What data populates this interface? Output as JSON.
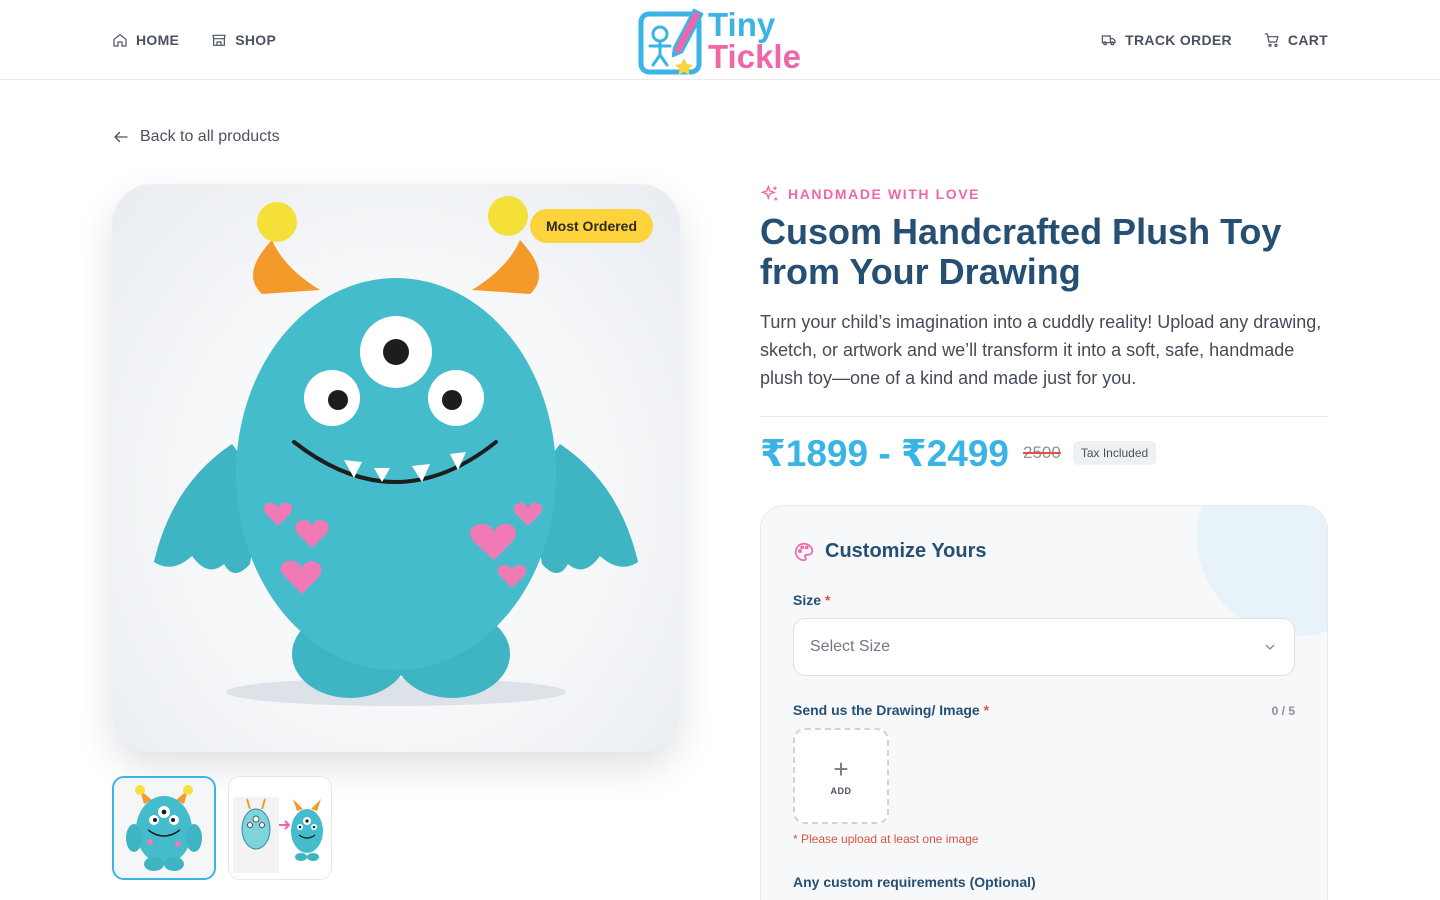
{
  "nav": {
    "home": "HOME",
    "shop": "SHOP",
    "track_order": "TRACK ORDER",
    "cart": "CART"
  },
  "logo": {
    "line1": "Tiny",
    "line2": "Tickle"
  },
  "back_link": "Back to all products",
  "product": {
    "badge": "Most Ordered",
    "eyebrow": "HANDMADE WITH LOVE",
    "title": "Cusom Handcrafted Plush Toy from Your Drawing",
    "description": "Turn your child’s imagination into a cuddly reality! Upload any drawing, sketch, or artwork and we’ll transform it into a soft, safe, handmade plush toy—one of a kind and made just for you.",
    "price": "₹1899 - ₹2499",
    "original_price": "2500",
    "tax_note": "Tax Included"
  },
  "customize": {
    "title": "Customize Yours",
    "size_label": "Size",
    "required_mark": "*",
    "size_placeholder": "Select Size",
    "drawing_label": "Send us the Drawing/ Image",
    "upload_count": "0 / 5",
    "upload_add": "ADD",
    "upload_plus": "+",
    "upload_error": "* Please upload at least one image",
    "custom_req_label": "Any custom requirements (Optional)"
  },
  "colors": {
    "brand_blue": "#39b4e4",
    "brand_pink": "#f066a8",
    "title_navy": "#264f74",
    "badge_yellow": "#fdd33c",
    "error_red": "#e0523f"
  }
}
